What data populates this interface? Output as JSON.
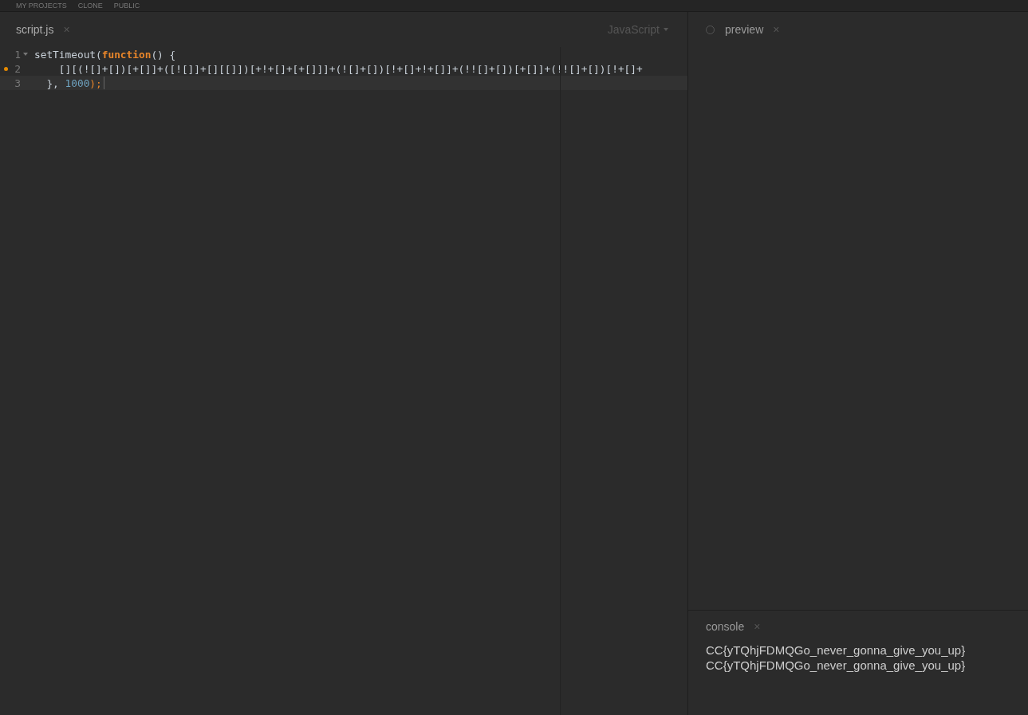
{
  "top_nav": {
    "items": [
      "MY PROJECTS",
      "CLONE",
      "PUBLIC"
    ]
  },
  "editor": {
    "tab": {
      "label": "script.js",
      "close": "×"
    },
    "language": "JavaScript",
    "lines": [
      {
        "number": "1",
        "foldable": true,
        "warning": false,
        "active": false,
        "tokens": [
          {
            "kind": "plain",
            "text": "setTimeout("
          },
          {
            "kind": "keyword",
            "text": "function"
          },
          {
            "kind": "plain",
            "text": "() {"
          }
        ]
      },
      {
        "number": "2",
        "foldable": false,
        "warning": true,
        "active": false,
        "tokens": [
          {
            "kind": "plain",
            "text": "    [][(![]+[])[+[]]+([![]]+[][[]])[+!+[]+[+[]]]+(![]+[])[!+[]+!+[]]+(!![]+[])[+[]]+(!![]+[])[!+[]+"
          }
        ]
      },
      {
        "number": "3",
        "foldable": false,
        "warning": false,
        "active": true,
        "tokens": [
          {
            "kind": "plain",
            "text": "  },"
          },
          {
            "kind": "number",
            "text": " 1000"
          },
          {
            "kind": "punct",
            "text": ");"
          }
        ]
      }
    ]
  },
  "preview": {
    "title": "preview",
    "close": "×"
  },
  "console": {
    "title": "console",
    "close": "×",
    "lines": [
      "CC{yTQhjFDMQGo_never_gonna_give_you_up}",
      "CC{yTQhjFDMQGo_never_gonna_give_you_up}"
    ]
  }
}
